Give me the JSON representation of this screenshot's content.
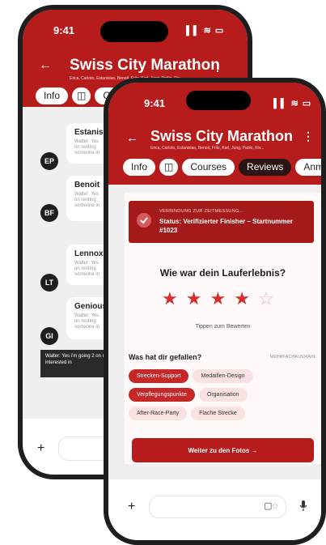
{
  "back_phone": {
    "time": "9:41",
    "status_icons": "▌▌ ≋ ▭",
    "title": "Swiss City Marathon",
    "subtitle": "Erica, Carloto, Estanislao, Benoit, Fritz, Karl, Jung, Pablo, Riv...",
    "tabs": [
      "Info",
      "Cou"
    ],
    "chats": [
      {
        "initials": "EP",
        "name": "Estanisla",
        "preview": "Walter: Yes on renting someone in"
      },
      {
        "initials": "BF",
        "name": "Benoit",
        "preview": "Walter: Yes on renting someone in"
      },
      {
        "initials": "LT",
        "name": "Lennox",
        "preview": "Walter: Yes on renting someone in"
      },
      {
        "initials": "GI",
        "name": "Genious",
        "preview": "Walter: Yes on renting someone in"
      }
    ],
    "dark_message": "Walter: Yes i'm going 2 on renting an appartm someone interested in"
  },
  "front_phone": {
    "time": "9:41",
    "status_icons": "▌▌ ≋ ▭",
    "title": "Swiss City Marathon",
    "subtitle": "Erica, Carloto, Estanislao, Benoit, Fritz, Karl, Jung, Pablo, Riv...",
    "tabs": [
      "Info",
      "Courses",
      "Reviews",
      "Anmeldun"
    ],
    "active_tab": "Reviews",
    "banner": {
      "label": "VERBINDUNG ZUR ZEITMESSUNG...",
      "status": "Status: Verifizierter Finisher – Startnummer #1023"
    },
    "question": "Wie war dein Lauferlebnis?",
    "rating": {
      "value": 4,
      "max": 5
    },
    "rating_hint": "Tippen zum Bewerten",
    "liked_heading": "Was hat dir gefallen?",
    "multi_select_label": "MEHRFACHAUSWAHL",
    "chips": [
      {
        "label": "Strecken-Support",
        "selected": true
      },
      {
        "label": "Medaillen-Design",
        "selected": false
      },
      {
        "label": "Verpflegungspunkte",
        "selected": true
      },
      {
        "label": "Organisation",
        "selected": false
      },
      {
        "label": "After-Race-Party",
        "selected": false
      },
      {
        "label": "Flache Strecke",
        "selected": false
      }
    ],
    "cta_label": "Weiter zu den Fotos →"
  },
  "colors": {
    "brand_red": "#b71c1c",
    "selected_chip": "#c62828",
    "chip_bg": "#fbe2e2"
  }
}
